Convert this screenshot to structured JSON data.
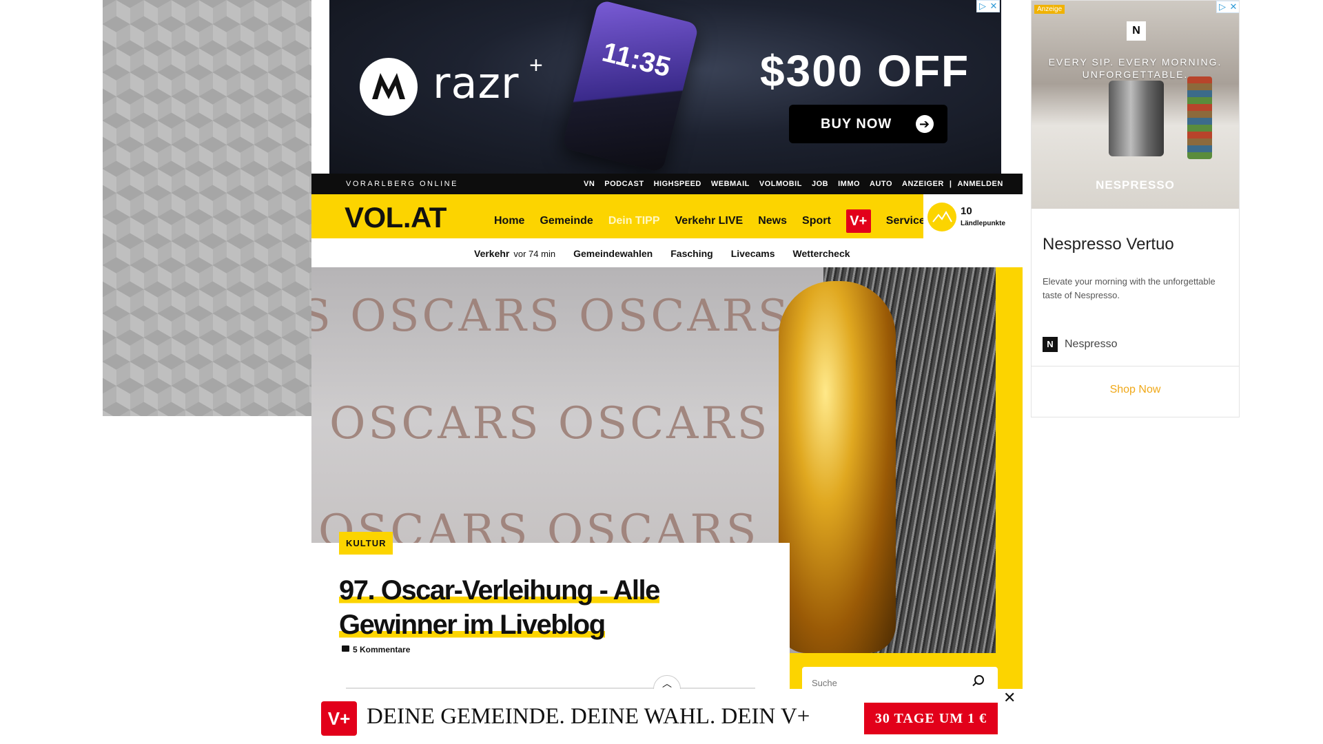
{
  "top_ad": {
    "brand": "razr",
    "brand_plus": "+",
    "phone_time": "11:35",
    "offer": "$300 OFF",
    "cta": "BUY NOW",
    "adchoice_i": "▷",
    "adchoice_x": "✕"
  },
  "side_ad": {
    "label": "Anzeige",
    "badge": "N",
    "tagline": "EVERY SIP. EVERY MORNING. UNFORGETTABLE.",
    "image_brand": "NESPRESSO",
    "title": "Nespresso Vertuo",
    "description": "Elevate your morning with the unforgettable taste of Nespresso.",
    "brand": "Nespresso",
    "cta": "Shop Now"
  },
  "topbar": {
    "brand": "VORARLBERG ONLINE",
    "links": [
      "VN",
      "PODCAST",
      "HIGHSPEED",
      "WEBMAIL",
      "VOLMOBIL",
      "JOB",
      "IMMO",
      "AUTO",
      "ANZEIGER",
      "|",
      "ANMELDEN"
    ]
  },
  "nav": {
    "logo": "VOL.AT",
    "items": [
      "Home",
      "Gemeinde",
      "Dein TIPP",
      "Verkehr LIVE",
      "News",
      "Sport"
    ],
    "vplus": "V+",
    "service": "Service",
    "points_value": "10",
    "points_label": "Ländlepunkte"
  },
  "subnav": {
    "items": [
      "Verkehr",
      "vor 74 min",
      "Gemeindewahlen",
      "Fasching",
      "Livecams",
      "Wettercheck"
    ]
  },
  "hero": {
    "oscars_words": [
      "S OSCARS OSCARS",
      "OSCARS OSCARS",
      "OSCARS OSCARS"
    ]
  },
  "article": {
    "category": "KULTUR",
    "headline_line1": "97. Oscar-Verleihung - Alle",
    "headline_line2": "Gewinner im Liveblog",
    "comments": "5 Kommentare"
  },
  "search": {
    "placeholder": "Suche"
  },
  "bottom_bar": {
    "vplus": "V+",
    "text": "DEINE GEMEINDE. DEINE WAHL. DEIN V+",
    "cta": "30 TAGE UM 1 €",
    "close": "✕"
  },
  "colors": {
    "brand_yellow": "#fcd400",
    "vplus_red": "#e2001a",
    "topbar_black": "#0d0d0d",
    "side_cta_orange": "#f0a818"
  }
}
